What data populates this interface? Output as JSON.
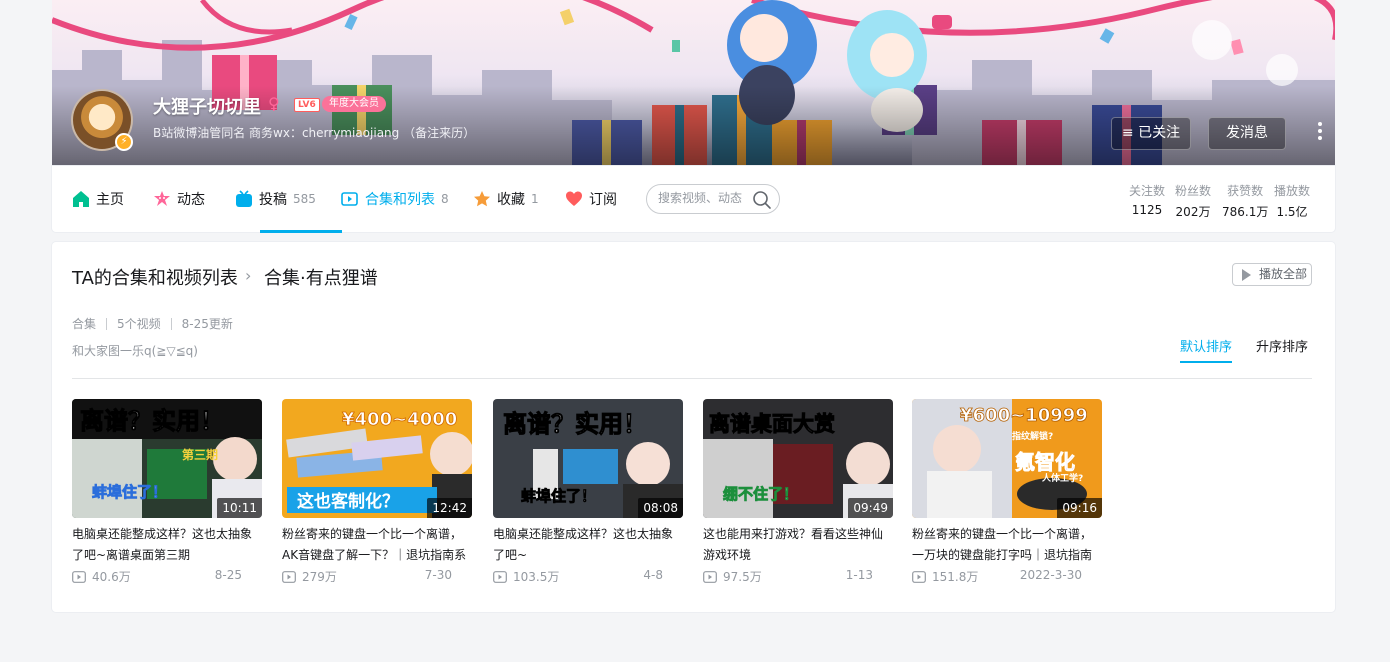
{
  "profile": {
    "name": "大狸子切切里",
    "gender_symbol": "♀",
    "level": "LV6",
    "vip_label": "年度大会员",
    "sign": "B站微博油管同名 商务wx：cherrymiaojiang （备注来历）",
    "follow_button": "已关注",
    "follow_icon": "≡",
    "message_button": "发消息"
  },
  "nav": {
    "items": [
      {
        "label": "主页",
        "count": "",
        "icon": "home-icon",
        "color": "#00c091"
      },
      {
        "label": "动态",
        "count": "",
        "icon": "dynamic-icon",
        "color": "#ff6699"
      },
      {
        "label": "投稿",
        "count": "585",
        "icon": "tv-icon",
        "color": "#00aeec"
      },
      {
        "label": "合集和列表",
        "count": "8",
        "icon": "playlist-icon",
        "color": "#00aeec"
      },
      {
        "label": "收藏",
        "count": "1",
        "icon": "star-icon",
        "color": "#f69c39"
      },
      {
        "label": "订阅",
        "count": "",
        "icon": "heart-icon",
        "color": "#ff5c5c"
      }
    ],
    "active_index": 3,
    "search_placeholder": "搜索视频、动态"
  },
  "stats": [
    {
      "label": "关注数",
      "value": "1125"
    },
    {
      "label": "粉丝数",
      "value": "202万"
    },
    {
      "label": "获赞数",
      "value": "786.1万"
    },
    {
      "label": "播放数",
      "value": "1.5亿"
    }
  ],
  "collection": {
    "breadcrumb_root": "TA的合集和视频列表",
    "breadcrumb_sep": "›",
    "title": "合集·有点狸谱",
    "play_all": "播放全部",
    "meta": [
      "合集",
      "5个视频",
      "8-25更新"
    ],
    "description": "和大家图一乐q(≧▽≦q)",
    "sort_default": "默认排序",
    "sort_asc": "升序排序"
  },
  "videos": [
    {
      "title": "电脑桌还能整成这样？这也太抽象了吧~离谱桌面第三期",
      "duration": "10:11",
      "views": "40.6万",
      "date": "8-25",
      "thumb_text": "离谱？实用！",
      "thumb_sub": "蚌埠住了！",
      "thumb_tag": "第三期"
    },
    {
      "title": "粉丝寄来的键盘一个比一个离谱，AK音键盘了解一下？｜退坑指南系",
      "duration": "12:42",
      "views": "279万",
      "date": "7-30",
      "thumb_text": "¥400~4000",
      "thumb_sub": "这也客制化？",
      "thumb_tag": ""
    },
    {
      "title": "电脑桌还能整成这样？这也太抽象了吧~",
      "duration": "08:08",
      "views": "103.5万",
      "date": "4-8",
      "thumb_text": "离谱？实用！",
      "thumb_sub": "蚌埠住了！",
      "thumb_tag": ""
    },
    {
      "title": "这也能用来打游戏？看看这些神仙游戏环境",
      "duration": "09:49",
      "views": "97.5万",
      "date": "1-13",
      "thumb_text": "离谱桌面大赏",
      "thumb_sub": "绷不住了！",
      "thumb_tag": ""
    },
    {
      "title": "粉丝寄来的键盘一个比一个离谱，一万块的键盘能打字吗｜退坑指南",
      "duration": "09:16",
      "views": "151.8万",
      "date": "2022-3-30",
      "thumb_text": "¥600~10999",
      "thumb_sub": "氪智化",
      "thumb_tag": "指纹解锁?",
      "thumb_tag2": "人体工学?"
    }
  ]
}
